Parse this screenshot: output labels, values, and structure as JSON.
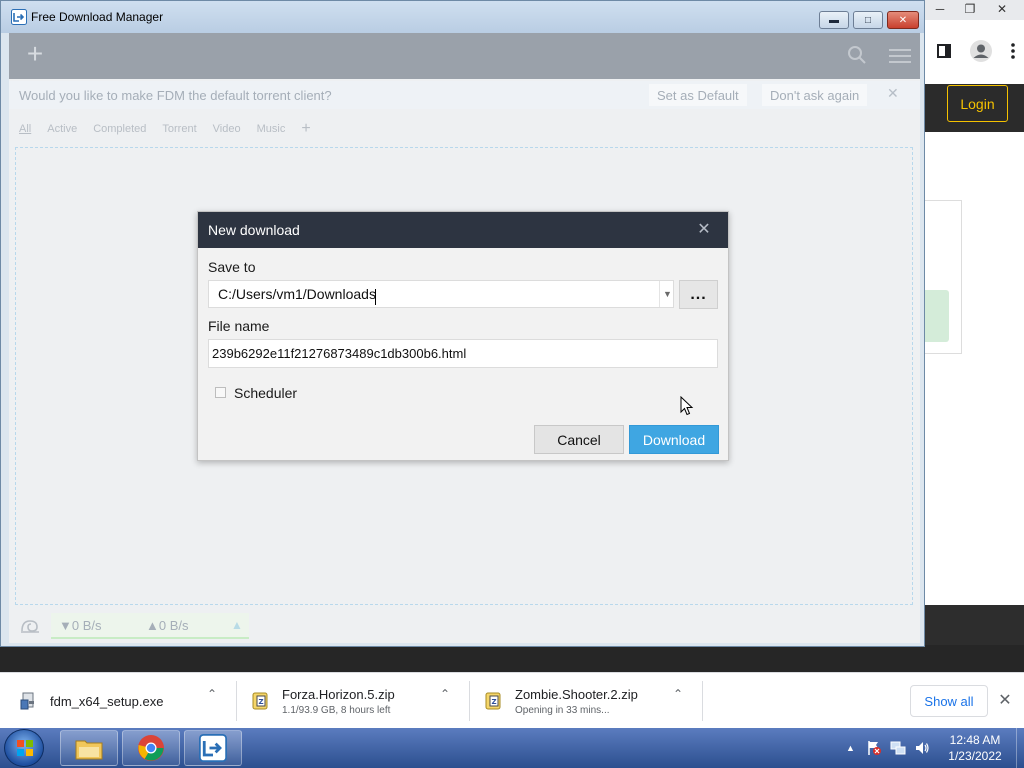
{
  "colors": {
    "dialog_header": "#2d3441",
    "download_button": "#3fa6e2",
    "login_accent": "#f5c200",
    "taskbar": "#2c4f8f"
  },
  "background_browser": {
    "login_label": "Login"
  },
  "fdm_window": {
    "title": "Free Download Manager",
    "toolbar": {
      "add_icon": "plus-icon",
      "search_icon": "search-icon",
      "menu_icon": "hamburger-menu-icon"
    },
    "torrent_banner": {
      "text": "Would you like to make FDM the default torrent client?",
      "set_default_label": "Set as Default",
      "dont_ask_label": "Don't ask again"
    },
    "filter_tabs": [
      "All",
      "Active",
      "Completed",
      "Torrent",
      "Video",
      "Music"
    ],
    "status_bar": {
      "download_speed": "▼0 B/s",
      "upload_speed": "▲0 B/s"
    }
  },
  "dialog": {
    "title": "New download",
    "save_to_label": "Save to",
    "save_to_value": "C:/Users/vm1/Downloads",
    "browse_label": "...",
    "file_name_label": "File name",
    "file_name_value": "239b6292e11f21276873489c1db300b6.html",
    "scheduler_label": "Scheduler",
    "scheduler_checked": false,
    "cancel_label": "Cancel",
    "download_label": "Download"
  },
  "downloads_bar": {
    "items": [
      {
        "name": "fdm_x64_setup.exe",
        "status": ""
      },
      {
        "name": "Forza.Horizon.5.zip",
        "status": "1.1/93.9 GB, 8 hours left"
      },
      {
        "name": "Zombie.Shooter.2.zip",
        "status": "Opening in 33 mins..."
      }
    ],
    "show_all_label": "Show all"
  },
  "taskbar": {
    "time": "12:48 AM",
    "date": "1/23/2022"
  }
}
